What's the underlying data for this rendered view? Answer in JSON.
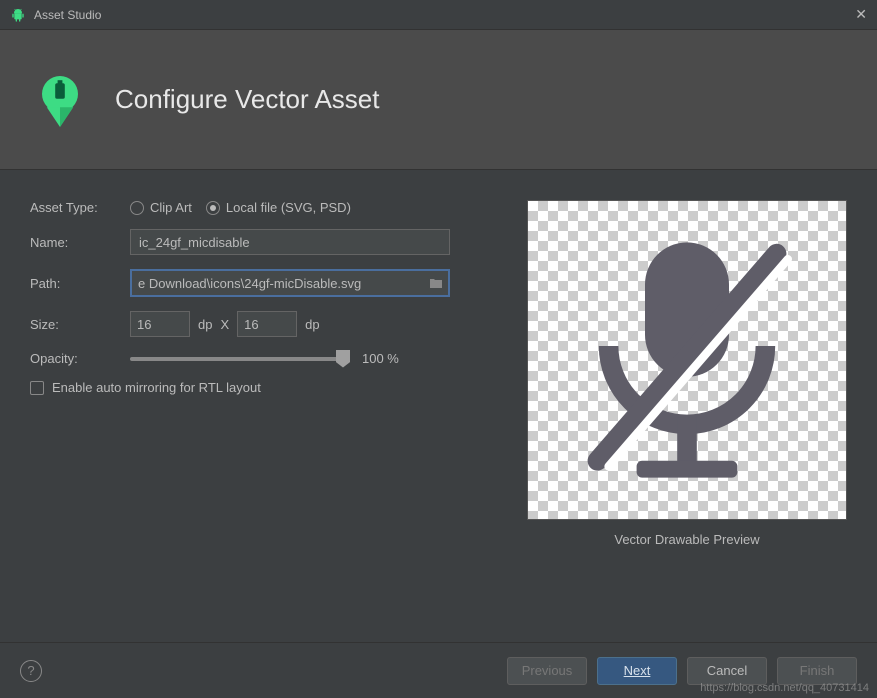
{
  "window": {
    "title": "Asset Studio"
  },
  "header": {
    "title": "Configure Vector Asset"
  },
  "form": {
    "assetType": {
      "label": "Asset Type:",
      "options": {
        "clipArt": "Clip Art",
        "localFile": "Local file (SVG, PSD)"
      },
      "selected": "localFile"
    },
    "name": {
      "label": "Name:",
      "value": "ic_24gf_micdisable"
    },
    "path": {
      "label": "Path:",
      "value": "e Download\\icons\\24gf-micDisable.svg"
    },
    "size": {
      "label": "Size:",
      "width": "16",
      "height": "16",
      "unit": "dp",
      "separator": "X"
    },
    "opacity": {
      "label": "Opacity:",
      "value": "100 %"
    },
    "rtl": {
      "label": "Enable auto mirroring for RTL layout",
      "checked": false
    }
  },
  "preview": {
    "label": "Vector Drawable Preview"
  },
  "footer": {
    "previous": "Previous",
    "next": "Next",
    "cancel": "Cancel",
    "finish": "Finish"
  },
  "watermark": "https://blog.csdn.net/qq_40731414"
}
